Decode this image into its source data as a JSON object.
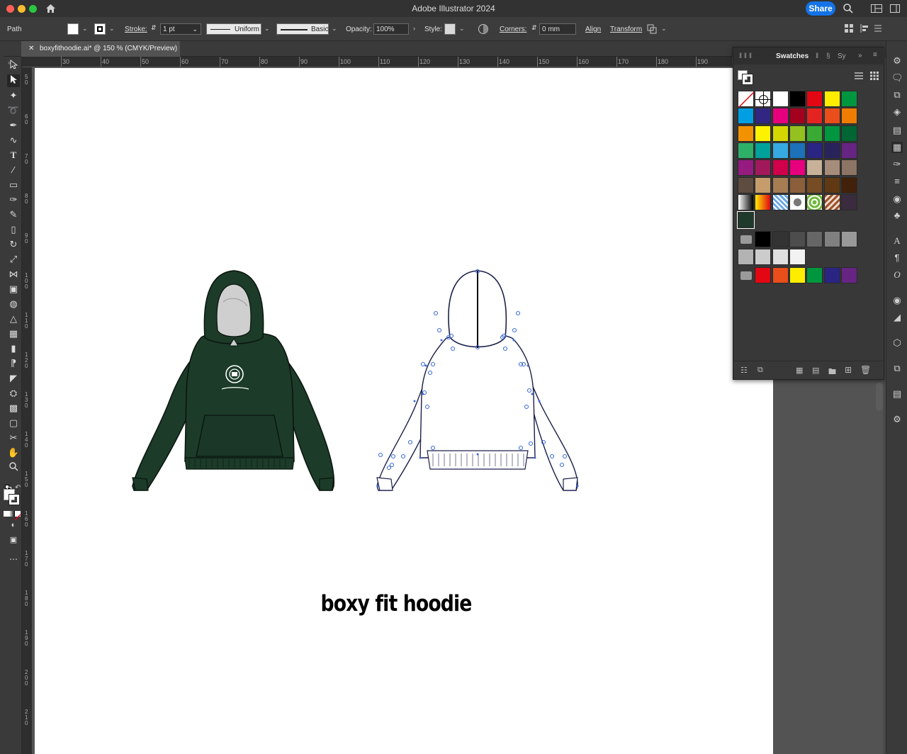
{
  "app": {
    "title": "Adobe Illustrator 2024",
    "share_label": "Share"
  },
  "control_bar": {
    "selection_type": "Path",
    "stroke_label": "Stroke:",
    "stroke_weight": "1 pt",
    "profile_label": "Uniform",
    "brush_label": "Basic",
    "opacity_label": "Opacity:",
    "opacity_value": "100%",
    "style_label": "Style:",
    "corners_label": "Corners:",
    "corners_value": "0 mm",
    "align_label": "Align",
    "transform_label": "Transform"
  },
  "document": {
    "tab_title": "boxyfithoodie.ai* @ 150 % (CMYK/Preview)"
  },
  "rulers": {
    "horizontal_ticks": [
      "30",
      "40",
      "50",
      "60",
      "70",
      "80",
      "90",
      "100",
      "110",
      "120",
      "130",
      "140",
      "150",
      "160",
      "170",
      "180",
      "190"
    ],
    "vertical_ticks": [
      "50",
      "60",
      "70",
      "80",
      "90",
      "100",
      "110",
      "120",
      "130",
      "140",
      "150",
      "160",
      "170",
      "180",
      "190",
      "200",
      "210"
    ]
  },
  "artboard": {
    "caption": "boxy fit hoodie"
  },
  "swatches_panel": {
    "title": "Swatches",
    "other_tabs": [
      "Sy"
    ],
    "rows": [
      [
        "none",
        "registration",
        "#ffffff",
        "#000000",
        "#e30613",
        "#ffed00",
        "#009640"
      ],
      [
        "#009fe3",
        "#312783",
        "#e6007e",
        "#a3001e",
        "#e52421",
        "#e94e1b",
        "#ef7d00"
      ],
      [
        "#f39200",
        "#fff200",
        "#d3d800",
        "#95c11f",
        "#3aaa35",
        "#009640",
        "#006633"
      ],
      [
        "#2eb069",
        "#00a19a",
        "#36a9e1",
        "#1d71b8",
        "#2a2483",
        "#29235c",
        "#662483"
      ],
      [
        "#951b81",
        "#a2195b",
        "#d0004b",
        "#e6007e",
        "#c7b299",
        "#a68c7a",
        "#8c7565"
      ],
      [
        "#5d4c3f",
        "#c69c6d",
        "#a67c52",
        "#8b5e3c",
        "#754c24",
        "#603913",
        "#42210b"
      ]
    ],
    "pattern_row": [
      "gradient-bw",
      "gradient-orange",
      "pattern-blue",
      "pattern-dots",
      "pattern-leaves",
      "pattern-paisley",
      "#3a2b3e"
    ],
    "selected_swatch": "#1f3a2a",
    "gray_group": [
      "#000000",
      "#333333",
      "#4d4d4d",
      "#666666",
      "#808080",
      "#999999",
      "#b3b3b3",
      "#cccccc",
      "#e0e0e0",
      "#f2f2f2"
    ],
    "bright_group": [
      "#e30613",
      "#e94e1b",
      "#ffed00",
      "#009640",
      "#2a2483",
      "#662483"
    ]
  },
  "colors": {
    "hoodie_green": "#1c3b29",
    "accent_blue": "#1473e6",
    "anchor_blue": "#3c6bd6"
  },
  "icons": {
    "tools": [
      "selection-icon",
      "direct-selection-icon",
      "magic-wand-icon",
      "lasso-icon",
      "pen-icon",
      "curvature-icon",
      "type-icon",
      "line-icon",
      "rectangle-icon",
      "paintbrush-icon",
      "blob-brush-icon",
      "eraser-icon",
      "rotate-icon",
      "scale-icon",
      "width-icon",
      "free-transform-icon",
      "shape-builder-icon",
      "perspective-icon",
      "mesh-icon",
      "gradient-icon",
      "eyedropper-icon",
      "blend-icon",
      "symbol-sprayer-icon",
      "graph-icon",
      "artboard-icon",
      "slice-icon",
      "hand-icon",
      "zoom-icon"
    ],
    "dock": [
      "properties-icon",
      "comments-icon",
      "libraries-icon",
      "layers-icon",
      "asset-export-icon",
      "swatches-icon",
      "brushes-icon",
      "stroke-icon",
      "color-icon",
      "symbols-icon",
      "character-icon",
      "paragraph-icon",
      "opentype-icon",
      "appearance-icon",
      "graphic-styles-icon",
      "3d-icon",
      "pathfinder-icon",
      "links-icon",
      "css-icon"
    ]
  }
}
